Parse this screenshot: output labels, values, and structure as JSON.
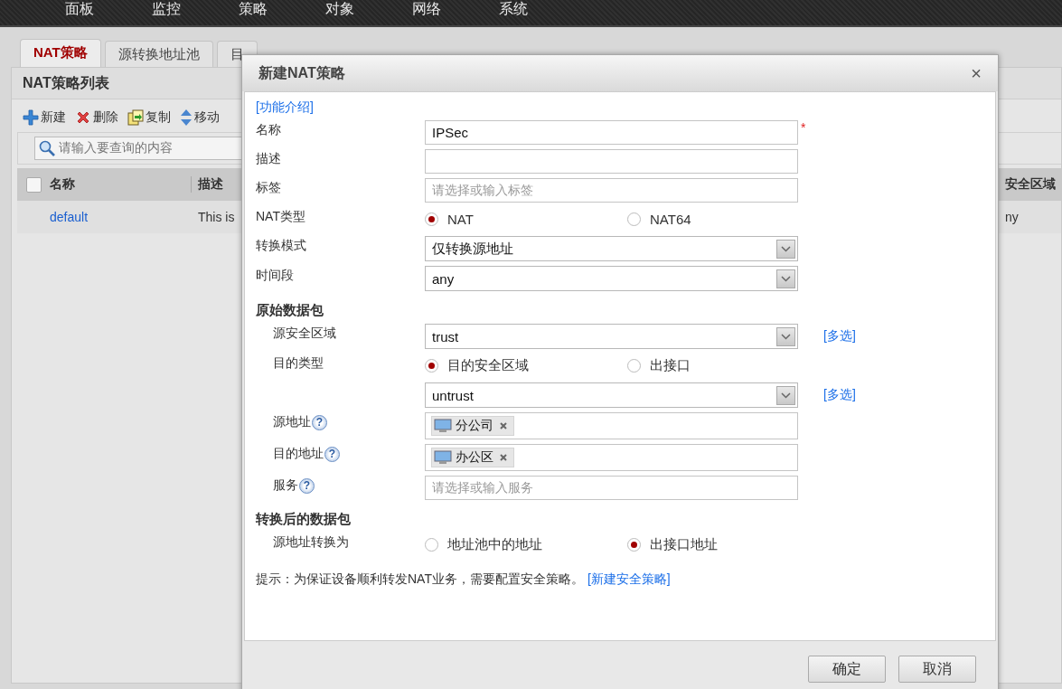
{
  "nav": [
    {
      "label": "面板"
    },
    {
      "label": "监控"
    },
    {
      "label": "策略"
    },
    {
      "label": "对象"
    },
    {
      "label": "网络"
    },
    {
      "label": "系统"
    }
  ],
  "tabs": [
    {
      "label": "NAT策略",
      "selected": true
    },
    {
      "label": "源转换地址池",
      "selected": false
    },
    {
      "label": "目",
      "selected": false
    }
  ],
  "panel": {
    "title": "NAT策略列表",
    "toolbar": [
      {
        "kind": "add",
        "label": "新建"
      },
      {
        "kind": "delete",
        "label": "删除"
      },
      {
        "kind": "copy",
        "label": "复制"
      },
      {
        "kind": "move",
        "label": "移动"
      }
    ],
    "search": {
      "placeholder": "请输入要查询的内容"
    },
    "table": {
      "select_all": {
        "checked": false
      },
      "columns": [
        "名称",
        "描述",
        "安全区域"
      ],
      "rows": [
        [
          "default",
          "This is",
          "ny"
        ]
      ]
    }
  },
  "dialog": {
    "title": "新建NAT策略",
    "close": "×",
    "intro_link": "[功能介绍]",
    "fields": [
      {
        "kind": "input",
        "label": "名称",
        "value": "IPSec",
        "required": "*"
      },
      {
        "kind": "input",
        "label": "描述"
      },
      {
        "kind": "input",
        "label": "标签",
        "placeholder": "请选择或输入标签"
      },
      {
        "kind": "radio",
        "label": "NAT类型",
        "options": [
          {
            "label": "NAT",
            "selected": true
          },
          {
            "label": "NAT64",
            "selected": false
          }
        ]
      },
      {
        "kind": "select",
        "label": "转换模式",
        "value": "仅转换源地址"
      },
      {
        "kind": "select",
        "label": "时间段",
        "value": "any"
      }
    ],
    "sections": [
      {
        "title": "原始数据包",
        "fields": [
          {
            "kind": "select",
            "label": "源安全区域",
            "value": "trust",
            "link": "[多选]"
          },
          {
            "kind": "radio",
            "label": "目的类型",
            "options": [
              {
                "label": "目的安全区域",
                "selected": true
              },
              {
                "label": "出接口",
                "selected": false
              }
            ]
          },
          {
            "kind": "select",
            "value": "untrust",
            "link": "[多选]"
          },
          {
            "kind": "tags",
            "label": "源地址",
            "help": "?",
            "tags": [
              "分公司"
            ]
          },
          {
            "kind": "tags",
            "label": "目的地址",
            "help": "?",
            "tags": [
              "办公区"
            ]
          },
          {
            "kind": "input",
            "label": "服务",
            "help": "?",
            "placeholder": "请选择或输入服务"
          }
        ]
      },
      {
        "title": "转换后的数据包",
        "fields": [
          {
            "kind": "radio",
            "label": "源地址转换为",
            "options": [
              {
                "label": "地址池中的地址",
                "selected": false
              },
              {
                "label": "出接口地址",
                "selected": true
              }
            ]
          }
        ]
      }
    ],
    "note": "提示：为保证设备顺利转发NAT业务，需要配置安全策略。",
    "note_link": "[新建安全策略]",
    "buttons": [
      "确定",
      "取消"
    ]
  }
}
